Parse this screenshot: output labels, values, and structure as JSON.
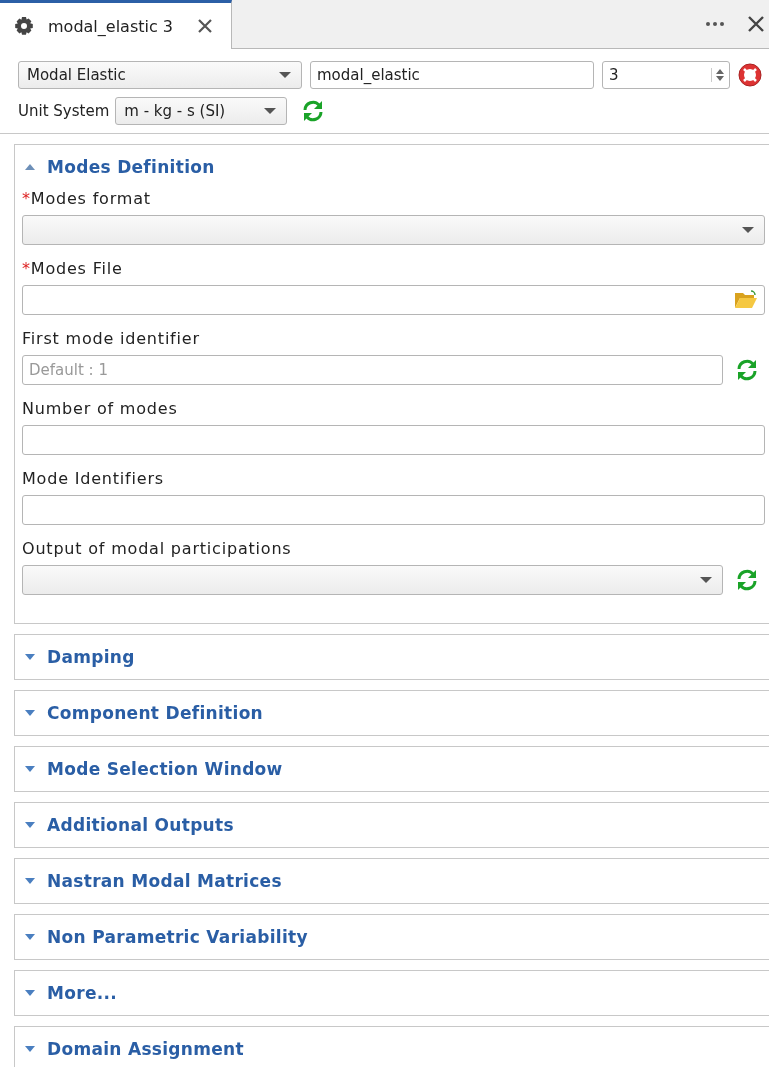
{
  "tab": {
    "title": "modal_elastic 3",
    "selected": true
  },
  "top": {
    "type": "Modal Elastic",
    "name": "modal_elastic",
    "number": "3"
  },
  "unit_system": {
    "label": "Unit System",
    "value": "m - kg - s (SI)"
  },
  "sections": [
    {
      "title": "Modes Definition",
      "expanded": true,
      "fields": [
        {
          "label": "Modes format",
          "required_mark": "*",
          "kind": "combo",
          "reset": false
        },
        {
          "label": "Modes File",
          "required_mark": "*",
          "kind": "file",
          "reset": false
        },
        {
          "label": "First mode identifier",
          "kind": "text",
          "placeholder": "Default : 1",
          "reset": true
        },
        {
          "label": "Number of modes",
          "kind": "text",
          "reset": false
        },
        {
          "label": "Mode Identifiers",
          "kind": "text",
          "reset": false
        },
        {
          "label": "Output of modal participations",
          "kind": "combo",
          "reset": true
        }
      ]
    },
    {
      "title": "Damping",
      "expanded": false
    },
    {
      "title": "Component Definition",
      "expanded": false
    },
    {
      "title": "Mode Selection Window",
      "expanded": false
    },
    {
      "title": "Additional Outputs",
      "expanded": false
    },
    {
      "title": "Nastran Modal Matrices",
      "expanded": false
    },
    {
      "title": "Non Parametric Variability",
      "expanded": false
    },
    {
      "title": "More...",
      "expanded": false
    },
    {
      "title": "Domain Assignment",
      "expanded": false
    }
  ]
}
